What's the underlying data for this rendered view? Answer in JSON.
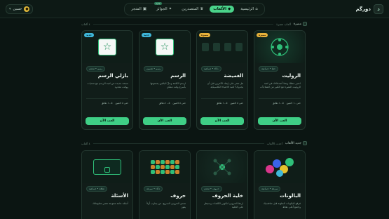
{
  "nav": {
    "brand": "دورگم",
    "items": [
      {
        "label": "الرئيسية",
        "active": false
      },
      {
        "label": "الألعاب",
        "active": true,
        "badge": ""
      },
      {
        "label": "المتصدرين",
        "active": false
      },
      {
        "label": "الجوائز",
        "active": false,
        "badge": "جديد"
      },
      {
        "label": "المتجر",
        "active": false
      }
    ],
    "user_label": "حسين",
    "user_icon": "coin-icon"
  },
  "sections": [
    {
      "title": "مميزة",
      "subtitle": "ألعاب مميزة",
      "count": "٤ ألعاب"
    },
    {
      "title": "جديد الألعاب",
      "subtitle": "أحدث الألعاب",
      "count": "٤ ألعاب"
    }
  ],
  "row1": [
    {
      "title": "الروليت",
      "tag": "مميزة",
      "tag_color": "#e8b23b",
      "meta": "حظ • جماعية",
      "desc": "اختبر حظك وتحدّ أصدقاءك في لعبة الروليت المثيرة مع الكثير من المفاجآت",
      "info": [
        "حتى ١٠ لاعبين",
        "٥-١٠ دقائق"
      ],
      "button": "العب الآن"
    },
    {
      "title": "الغميضة",
      "tag": "مميزة",
      "tag_color": "#e8b23b",
      "meta": "ذكاء • جماعية",
      "desc": "هل تقدر على إيجاد الآخرين قبل أن يجدوك؟ لعبة الاختباء الكلاسيكية",
      "info": [
        "حتى ٨ لاعبين",
        "٥-١٠ دقائق"
      ],
      "button": "العب الآن"
    },
    {
      "title": "الرسم",
      "tag": "جديد",
      "tag_color": "#3fb7d9",
      "meta": "رسم • تخمين",
      "desc": "ارسم الكلمة وخلّ الباقين يخمنونها بأسرع وقت ممكن",
      "info": [
        "حتى ٨ لاعبين",
        "٥-١٠ دقائق"
      ],
      "button": "العب الآن"
    },
    {
      "title": "بازلي الرسم",
      "tag": "جديد",
      "tag_color": "#3fb7d9",
      "meta": "رسم • تحدي",
      "desc": "نسخة جديدة من لعبة الرسم مع تحديات ووقت محدود",
      "info": [
        "حتى ٨ لاعبين",
        "٥-١٠ دقائق"
      ],
      "button": "العب الآن"
    }
  ],
  "row2": [
    {
      "title": "البالونات",
      "tag": "",
      "meta": "سرعة • جماعية",
      "desc": "فرقع البالونات الملونة قبل منافسيك واجمع أعلى نقاط"
    },
    {
      "title": "خلية الحروف",
      "tag": "",
      "meta": "حروف • تحدي",
      "desc": "اربط الحروف لتكوين الكلمات وسيطر على الخلية"
    },
    {
      "title": "حروف",
      "tag": "",
      "meta": "ذكاء • سرعة",
      "desc": "تحدي الحروف السريع، من يجاوب أولاً يفوز"
    },
    {
      "title": "الأسئلة",
      "tag": "",
      "meta": "ثقافة • جماعية",
      "desc": "أسئلة عامة متنوعة تختبر معلوماتك"
    }
  ]
}
